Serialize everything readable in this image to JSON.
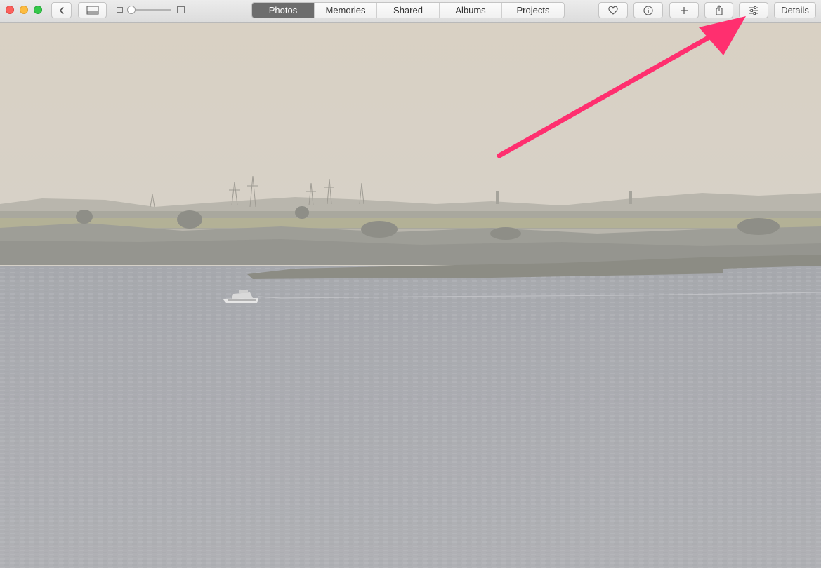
{
  "window": {
    "title": "Photos"
  },
  "toolbar": {
    "tabs": [
      {
        "label": "Photos",
        "active": true
      },
      {
        "label": "Memories",
        "active": false
      },
      {
        "label": "Shared",
        "active": false
      },
      {
        "label": "Albums",
        "active": false
      },
      {
        "label": "Projects",
        "active": false
      }
    ],
    "details_label": "Details",
    "icons": [
      "back-icon",
      "sidebar-icon",
      "heart-icon",
      "info-icon",
      "plus-icon",
      "share-icon",
      "adjust-icon"
    ]
  },
  "annotation": {
    "arrow_color": "#ff2f6f",
    "points_to": "adjust-button"
  },
  "colors": {
    "sky": "#d8d2c6",
    "water": "#a9aaaf",
    "land": "#8f8f86"
  }
}
